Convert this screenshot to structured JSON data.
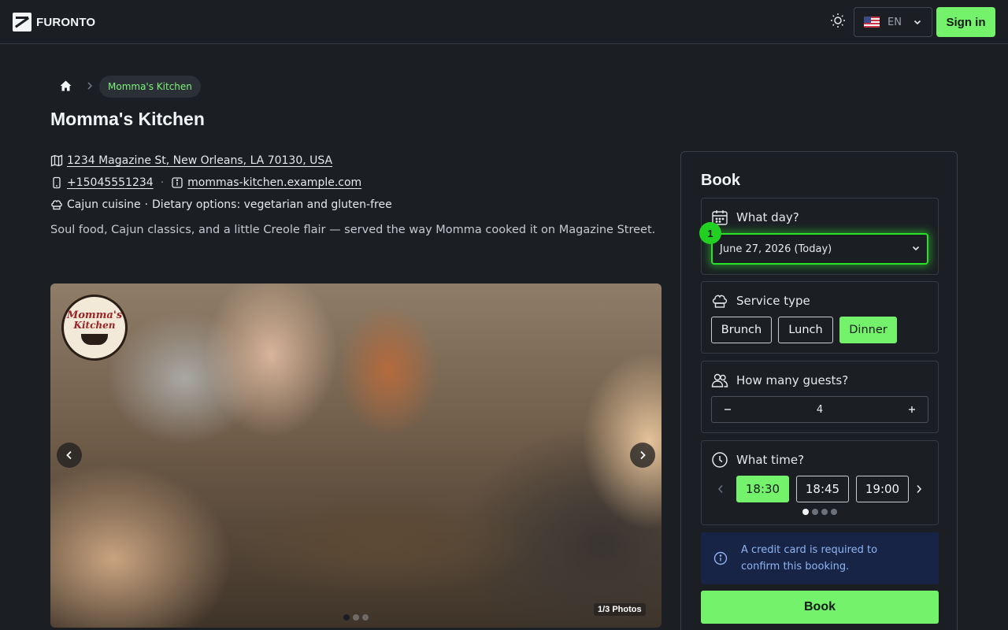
{
  "header": {
    "brand": "FURONTO",
    "lang_label": "EN",
    "signin_label": "Sign in"
  },
  "breadcrumb": {
    "current": "Momma's Kitchen"
  },
  "restaurant": {
    "name": "Momma's Kitchen",
    "address": "1234 Magazine St, New Orleans, LA 70130, USA",
    "phone": "+15045551234",
    "website": "mommas-kitchen.example.com",
    "cuisine": "Cajun cuisine",
    "dietary": "Dietary options: vegetarian and gluten-free",
    "description": "Soul food, Cajun classics, and a little Creole flair — served the way Momma cooked it on Magazine Street."
  },
  "gallery": {
    "logo_line1": "Momma's",
    "logo_line2": "Kitchen",
    "photo_count": "1/3 Photos",
    "dots": 3,
    "active_dot": 0
  },
  "booking": {
    "title": "Book",
    "day_label": "What day?",
    "date_value": "June 27, 2026 (Today)",
    "step_badge": "1",
    "service_label": "Service type",
    "services": [
      "Brunch",
      "Lunch",
      "Dinner"
    ],
    "selected_service": "Dinner",
    "guests_label": "How many guests?",
    "guests_value": "4",
    "time_label": "What time?",
    "times": [
      "18:30",
      "18:45",
      "19:00"
    ],
    "selected_time": "18:30",
    "time_page_dots": 4,
    "notice": "A credit card is required to confirm this booking.",
    "book_button": "Book"
  },
  "colors": {
    "accent": "#74f26c",
    "focus_ring": "#28e228",
    "background": "#1b1f24",
    "notice_bg": "#172446",
    "notice_text": "#8fb4f2"
  }
}
